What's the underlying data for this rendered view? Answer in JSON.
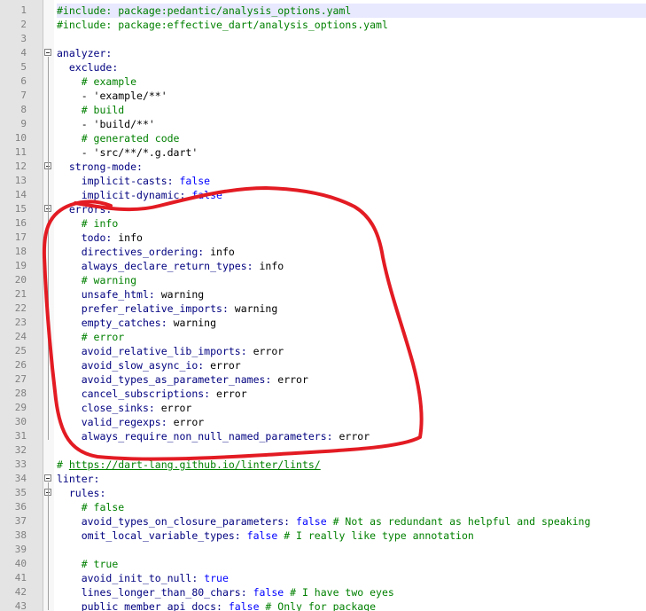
{
  "editor": {
    "current_line": 1,
    "annotation_color": "#e31b23",
    "lines": [
      {
        "n": "1",
        "indent": "",
        "parts": [
          {
            "t": "#include: package:pedantic/analysis_options.yaml",
            "c": "dir"
          }
        ]
      },
      {
        "n": "2",
        "indent": "",
        "parts": [
          {
            "t": "#include: package:effective_dart/analysis_options.yaml",
            "c": "dir"
          }
        ]
      },
      {
        "n": "3",
        "indent": "",
        "parts": []
      },
      {
        "n": "4",
        "indent": "",
        "parts": [
          {
            "t": "analyzer:",
            "c": "key"
          }
        ]
      },
      {
        "n": "5",
        "indent": "  ",
        "parts": [
          {
            "t": "exclude:",
            "c": "key"
          }
        ]
      },
      {
        "n": "6",
        "indent": "    ",
        "parts": [
          {
            "t": "# example",
            "c": "cmt"
          }
        ]
      },
      {
        "n": "7",
        "indent": "    ",
        "parts": [
          {
            "t": "- 'example/**'",
            "c": "str"
          }
        ]
      },
      {
        "n": "8",
        "indent": "    ",
        "parts": [
          {
            "t": "# build",
            "c": "cmt"
          }
        ]
      },
      {
        "n": "9",
        "indent": "    ",
        "parts": [
          {
            "t": "- 'build/**'",
            "c": "str"
          }
        ]
      },
      {
        "n": "10",
        "indent": "    ",
        "parts": [
          {
            "t": "# generated code",
            "c": "cmt"
          }
        ]
      },
      {
        "n": "11",
        "indent": "    ",
        "parts": [
          {
            "t": "- 'src/**/*.g.dart'",
            "c": "str"
          }
        ]
      },
      {
        "n": "12",
        "indent": "  ",
        "parts": [
          {
            "t": "strong-mode:",
            "c": "key"
          }
        ]
      },
      {
        "n": "13",
        "indent": "    ",
        "parts": [
          {
            "t": "implicit-casts:",
            "c": "key"
          },
          {
            "t": " false",
            "c": "kw"
          }
        ]
      },
      {
        "n": "14",
        "indent": "    ",
        "parts": [
          {
            "t": "implicit-dynamic:",
            "c": "key"
          },
          {
            "t": " false",
            "c": "kw"
          }
        ]
      },
      {
        "n": "15",
        "indent": "  ",
        "parts": [
          {
            "t": "errors:",
            "c": "key"
          }
        ]
      },
      {
        "n": "16",
        "indent": "    ",
        "parts": [
          {
            "t": "# info",
            "c": "cmt"
          }
        ]
      },
      {
        "n": "17",
        "indent": "    ",
        "parts": [
          {
            "t": "todo:",
            "c": "key"
          },
          {
            "t": " info",
            "c": "val"
          }
        ]
      },
      {
        "n": "18",
        "indent": "    ",
        "parts": [
          {
            "t": "directives_ordering:",
            "c": "key"
          },
          {
            "t": " info",
            "c": "val"
          }
        ]
      },
      {
        "n": "19",
        "indent": "    ",
        "parts": [
          {
            "t": "always_declare_return_types:",
            "c": "key"
          },
          {
            "t": " info",
            "c": "val"
          }
        ]
      },
      {
        "n": "20",
        "indent": "    ",
        "parts": [
          {
            "t": "# warning",
            "c": "cmt"
          }
        ]
      },
      {
        "n": "21",
        "indent": "    ",
        "parts": [
          {
            "t": "unsafe_html:",
            "c": "key"
          },
          {
            "t": " warning",
            "c": "val"
          }
        ]
      },
      {
        "n": "22",
        "indent": "    ",
        "parts": [
          {
            "t": "prefer_relative_imports:",
            "c": "key"
          },
          {
            "t": " warning",
            "c": "val"
          }
        ]
      },
      {
        "n": "23",
        "indent": "    ",
        "parts": [
          {
            "t": "empty_catches:",
            "c": "key"
          },
          {
            "t": " warning",
            "c": "val"
          }
        ]
      },
      {
        "n": "24",
        "indent": "    ",
        "parts": [
          {
            "t": "# error",
            "c": "cmt"
          }
        ]
      },
      {
        "n": "25",
        "indent": "    ",
        "parts": [
          {
            "t": "avoid_relative_lib_imports:",
            "c": "key"
          },
          {
            "t": " error",
            "c": "val"
          }
        ]
      },
      {
        "n": "26",
        "indent": "    ",
        "parts": [
          {
            "t": "avoid_slow_async_io:",
            "c": "key"
          },
          {
            "t": " error",
            "c": "val"
          }
        ]
      },
      {
        "n": "27",
        "indent": "    ",
        "parts": [
          {
            "t": "avoid_types_as_parameter_names:",
            "c": "key"
          },
          {
            "t": " error",
            "c": "val"
          }
        ]
      },
      {
        "n": "28",
        "indent": "    ",
        "parts": [
          {
            "t": "cancel_subscriptions:",
            "c": "key"
          },
          {
            "t": " error",
            "c": "val"
          }
        ]
      },
      {
        "n": "29",
        "indent": "    ",
        "parts": [
          {
            "t": "close_sinks:",
            "c": "key"
          },
          {
            "t": " error",
            "c": "val"
          }
        ]
      },
      {
        "n": "30",
        "indent": "    ",
        "parts": [
          {
            "t": "valid_regexps:",
            "c": "key"
          },
          {
            "t": " error",
            "c": "val"
          }
        ]
      },
      {
        "n": "31",
        "indent": "    ",
        "parts": [
          {
            "t": "always_require_non_null_named_parameters:",
            "c": "key"
          },
          {
            "t": " error",
            "c": "val"
          }
        ]
      },
      {
        "n": "32",
        "indent": "",
        "parts": []
      },
      {
        "n": "33",
        "indent": "",
        "parts": [
          {
            "t": "# ",
            "c": "cmt"
          },
          {
            "t": "https://dart-lang.github.io/linter/lints/",
            "c": "link"
          }
        ]
      },
      {
        "n": "34",
        "indent": "",
        "parts": [
          {
            "t": "linter:",
            "c": "key"
          }
        ]
      },
      {
        "n": "35",
        "indent": "  ",
        "parts": [
          {
            "t": "rules:",
            "c": "key"
          }
        ]
      },
      {
        "n": "36",
        "indent": "    ",
        "parts": [
          {
            "t": "# false",
            "c": "cmt"
          }
        ]
      },
      {
        "n": "37",
        "indent": "    ",
        "parts": [
          {
            "t": "avoid_types_on_closure_parameters:",
            "c": "key"
          },
          {
            "t": " false",
            "c": "kw"
          },
          {
            "t": " # Not as redundant as helpful and speaking",
            "c": "cmt"
          }
        ]
      },
      {
        "n": "38",
        "indent": "    ",
        "parts": [
          {
            "t": "omit_local_variable_types:",
            "c": "key"
          },
          {
            "t": " false",
            "c": "kw"
          },
          {
            "t": " # I really like type annotation",
            "c": "cmt"
          }
        ]
      },
      {
        "n": "39",
        "indent": "",
        "parts": []
      },
      {
        "n": "40",
        "indent": "    ",
        "parts": [
          {
            "t": "# true",
            "c": "cmt"
          }
        ]
      },
      {
        "n": "41",
        "indent": "    ",
        "parts": [
          {
            "t": "avoid_init_to_null:",
            "c": "key"
          },
          {
            "t": " true",
            "c": "kw"
          }
        ]
      },
      {
        "n": "42",
        "indent": "    ",
        "parts": [
          {
            "t": "lines_longer_than_80_chars:",
            "c": "key"
          },
          {
            "t": " false",
            "c": "kw"
          },
          {
            "t": " # I have two eyes",
            "c": "cmt"
          }
        ]
      },
      {
        "n": "43",
        "indent": "    ",
        "parts": [
          {
            "t": "public_member_api_docs:",
            "c": "key"
          },
          {
            "t": " false",
            "c": "kw"
          },
          {
            "t": " # Only for package",
            "c": "cmt"
          }
        ]
      }
    ],
    "fold_markers": [
      "4",
      "12",
      "15",
      "34",
      "35"
    ]
  }
}
